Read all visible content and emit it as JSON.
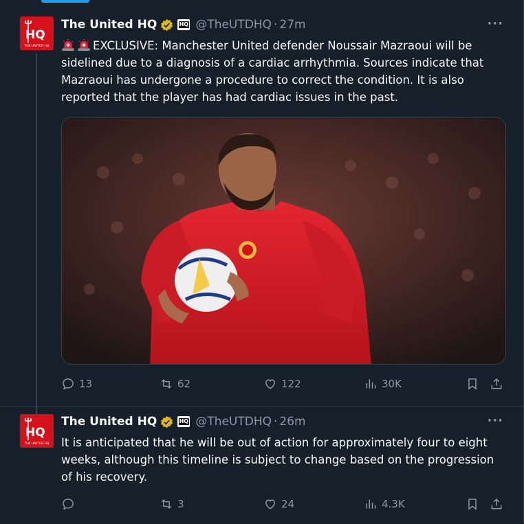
{
  "tweets": [
    {
      "author": {
        "name": "The United HQ",
        "handle": "@TheUTDHQ",
        "avatar_text": "HQ",
        "avatar_sub": "THE UNITED HQ",
        "affiliate_badge": "HQ"
      },
      "time": "27m",
      "icons": {
        "verified": "verified-badge-icon",
        "siren": "police-light-emoji"
      },
      "text": "EXCLUSIVE: Manchester United defender Noussair Mazraoui will be sidelined due to a diagnosis of a cardiac arrhythmia. Sources indicate that Mazraoui has undergone a procedure to correct the condition. It is also reported that the player has had cardiac issues in the past.",
      "has_image": true,
      "stats": {
        "replies": "13",
        "reposts": "62",
        "likes": "122",
        "views": "30K"
      }
    },
    {
      "author": {
        "name": "The United HQ",
        "handle": "@TheUTDHQ",
        "avatar_text": "HQ",
        "avatar_sub": "THE UNITED HQ",
        "affiliate_badge": "HQ"
      },
      "time": "26m",
      "text": "It is anticipated that he will be out of action for approximately four to eight weeks, although this timeline is subject to change based on the progression of his recovery.",
      "has_image": false,
      "stats": {
        "replies": "",
        "reposts": "3",
        "likes": "24",
        "views": "4.3K"
      }
    }
  ],
  "colors": {
    "background": "#15202b",
    "text": "#f7f9f9",
    "muted": "#8b98a5",
    "accent": "#1d9bf0",
    "brand": "#d5121b",
    "verified": "#e2b719"
  }
}
